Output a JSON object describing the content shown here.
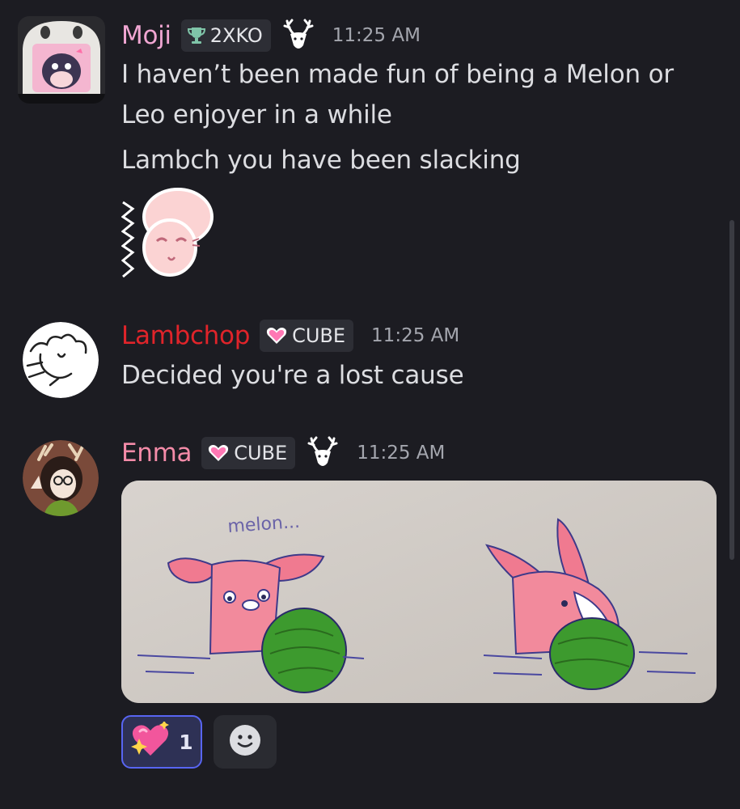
{
  "messages": [
    {
      "author": "Moji",
      "author_color": "#f0a6d2",
      "tag": {
        "icon": "trophy-icon",
        "label": "2XKO"
      },
      "role_icon": "deer-icon",
      "timestamp": "11:25 AM",
      "lines": [
        "I haven’t been made fun of being a Melon or",
        "Leo enjoyer in a while",
        "Lambch you have been slacking"
      ],
      "sticker": "pink-creature-sticker"
    },
    {
      "author": "Lambchop",
      "author_color": "#e0242a",
      "tag": {
        "icon": "pink-heart-icon",
        "label": "CUBE"
      },
      "timestamp": "11:25 AM",
      "lines": [
        "Decided you're a lost cause"
      ]
    },
    {
      "author": "Enma",
      "author_color": "#f48ba8",
      "tag": {
        "icon": "pink-heart-icon",
        "label": "CUBE"
      },
      "role_icon": "deer-icon",
      "timestamp": "11:25 AM",
      "attachment": {
        "type": "image",
        "handwritten_text": "melon..."
      },
      "reactions": [
        {
          "emoji": "sparkling-heart-icon",
          "count": "1",
          "active": true
        }
      ],
      "add_reaction_icon": "smiley-icon"
    }
  ],
  "colors": {
    "background": "#1c1c22",
    "text": "#dcdde1",
    "timestamp": "#a4a6ae",
    "tag_bg": "#2d2e35",
    "reaction_active_border": "#5865f2"
  }
}
